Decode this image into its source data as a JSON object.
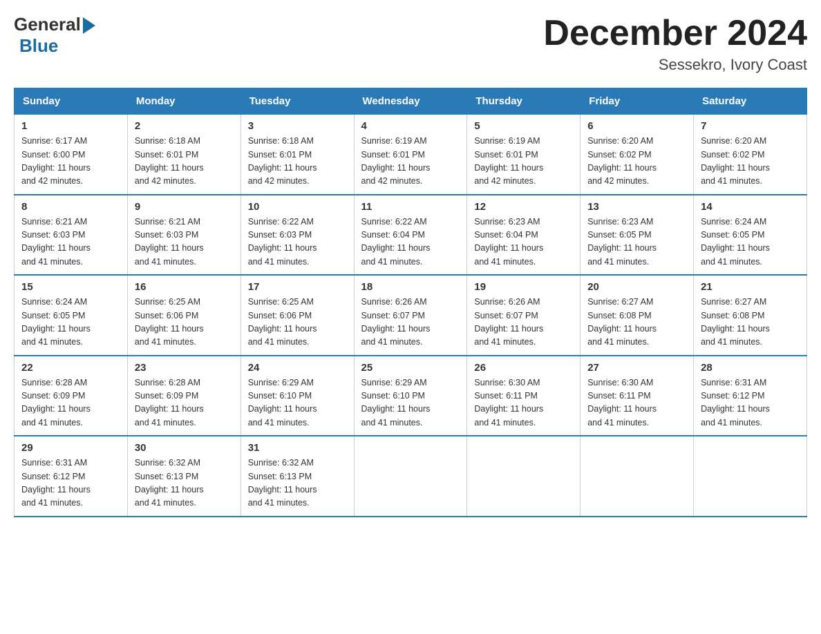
{
  "header": {
    "logo_general": "General",
    "logo_blue": "Blue",
    "month_title": "December 2024",
    "location": "Sessekro, Ivory Coast"
  },
  "days_of_week": [
    "Sunday",
    "Monday",
    "Tuesday",
    "Wednesday",
    "Thursday",
    "Friday",
    "Saturday"
  ],
  "weeks": [
    [
      {
        "day": "1",
        "sunrise": "6:17 AM",
        "sunset": "6:00 PM",
        "daylight": "11 hours and 42 minutes."
      },
      {
        "day": "2",
        "sunrise": "6:18 AM",
        "sunset": "6:01 PM",
        "daylight": "11 hours and 42 minutes."
      },
      {
        "day": "3",
        "sunrise": "6:18 AM",
        "sunset": "6:01 PM",
        "daylight": "11 hours and 42 minutes."
      },
      {
        "day": "4",
        "sunrise": "6:19 AM",
        "sunset": "6:01 PM",
        "daylight": "11 hours and 42 minutes."
      },
      {
        "day": "5",
        "sunrise": "6:19 AM",
        "sunset": "6:01 PM",
        "daylight": "11 hours and 42 minutes."
      },
      {
        "day": "6",
        "sunrise": "6:20 AM",
        "sunset": "6:02 PM",
        "daylight": "11 hours and 42 minutes."
      },
      {
        "day": "7",
        "sunrise": "6:20 AM",
        "sunset": "6:02 PM",
        "daylight": "11 hours and 41 minutes."
      }
    ],
    [
      {
        "day": "8",
        "sunrise": "6:21 AM",
        "sunset": "6:03 PM",
        "daylight": "11 hours and 41 minutes."
      },
      {
        "day": "9",
        "sunrise": "6:21 AM",
        "sunset": "6:03 PM",
        "daylight": "11 hours and 41 minutes."
      },
      {
        "day": "10",
        "sunrise": "6:22 AM",
        "sunset": "6:03 PM",
        "daylight": "11 hours and 41 minutes."
      },
      {
        "day": "11",
        "sunrise": "6:22 AM",
        "sunset": "6:04 PM",
        "daylight": "11 hours and 41 minutes."
      },
      {
        "day": "12",
        "sunrise": "6:23 AM",
        "sunset": "6:04 PM",
        "daylight": "11 hours and 41 minutes."
      },
      {
        "day": "13",
        "sunrise": "6:23 AM",
        "sunset": "6:05 PM",
        "daylight": "11 hours and 41 minutes."
      },
      {
        "day": "14",
        "sunrise": "6:24 AM",
        "sunset": "6:05 PM",
        "daylight": "11 hours and 41 minutes."
      }
    ],
    [
      {
        "day": "15",
        "sunrise": "6:24 AM",
        "sunset": "6:05 PM",
        "daylight": "11 hours and 41 minutes."
      },
      {
        "day": "16",
        "sunrise": "6:25 AM",
        "sunset": "6:06 PM",
        "daylight": "11 hours and 41 minutes."
      },
      {
        "day": "17",
        "sunrise": "6:25 AM",
        "sunset": "6:06 PM",
        "daylight": "11 hours and 41 minutes."
      },
      {
        "day": "18",
        "sunrise": "6:26 AM",
        "sunset": "6:07 PM",
        "daylight": "11 hours and 41 minutes."
      },
      {
        "day": "19",
        "sunrise": "6:26 AM",
        "sunset": "6:07 PM",
        "daylight": "11 hours and 41 minutes."
      },
      {
        "day": "20",
        "sunrise": "6:27 AM",
        "sunset": "6:08 PM",
        "daylight": "11 hours and 41 minutes."
      },
      {
        "day": "21",
        "sunrise": "6:27 AM",
        "sunset": "6:08 PM",
        "daylight": "11 hours and 41 minutes."
      }
    ],
    [
      {
        "day": "22",
        "sunrise": "6:28 AM",
        "sunset": "6:09 PM",
        "daylight": "11 hours and 41 minutes."
      },
      {
        "day": "23",
        "sunrise": "6:28 AM",
        "sunset": "6:09 PM",
        "daylight": "11 hours and 41 minutes."
      },
      {
        "day": "24",
        "sunrise": "6:29 AM",
        "sunset": "6:10 PM",
        "daylight": "11 hours and 41 minutes."
      },
      {
        "day": "25",
        "sunrise": "6:29 AM",
        "sunset": "6:10 PM",
        "daylight": "11 hours and 41 minutes."
      },
      {
        "day": "26",
        "sunrise": "6:30 AM",
        "sunset": "6:11 PM",
        "daylight": "11 hours and 41 minutes."
      },
      {
        "day": "27",
        "sunrise": "6:30 AM",
        "sunset": "6:11 PM",
        "daylight": "11 hours and 41 minutes."
      },
      {
        "day": "28",
        "sunrise": "6:31 AM",
        "sunset": "6:12 PM",
        "daylight": "11 hours and 41 minutes."
      }
    ],
    [
      {
        "day": "29",
        "sunrise": "6:31 AM",
        "sunset": "6:12 PM",
        "daylight": "11 hours and 41 minutes."
      },
      {
        "day": "30",
        "sunrise": "6:32 AM",
        "sunset": "6:13 PM",
        "daylight": "11 hours and 41 minutes."
      },
      {
        "day": "31",
        "sunrise": "6:32 AM",
        "sunset": "6:13 PM",
        "daylight": "11 hours and 41 minutes."
      },
      null,
      null,
      null,
      null
    ]
  ],
  "labels": {
    "sunrise": "Sunrise:",
    "sunset": "Sunset:",
    "daylight": "Daylight:"
  }
}
